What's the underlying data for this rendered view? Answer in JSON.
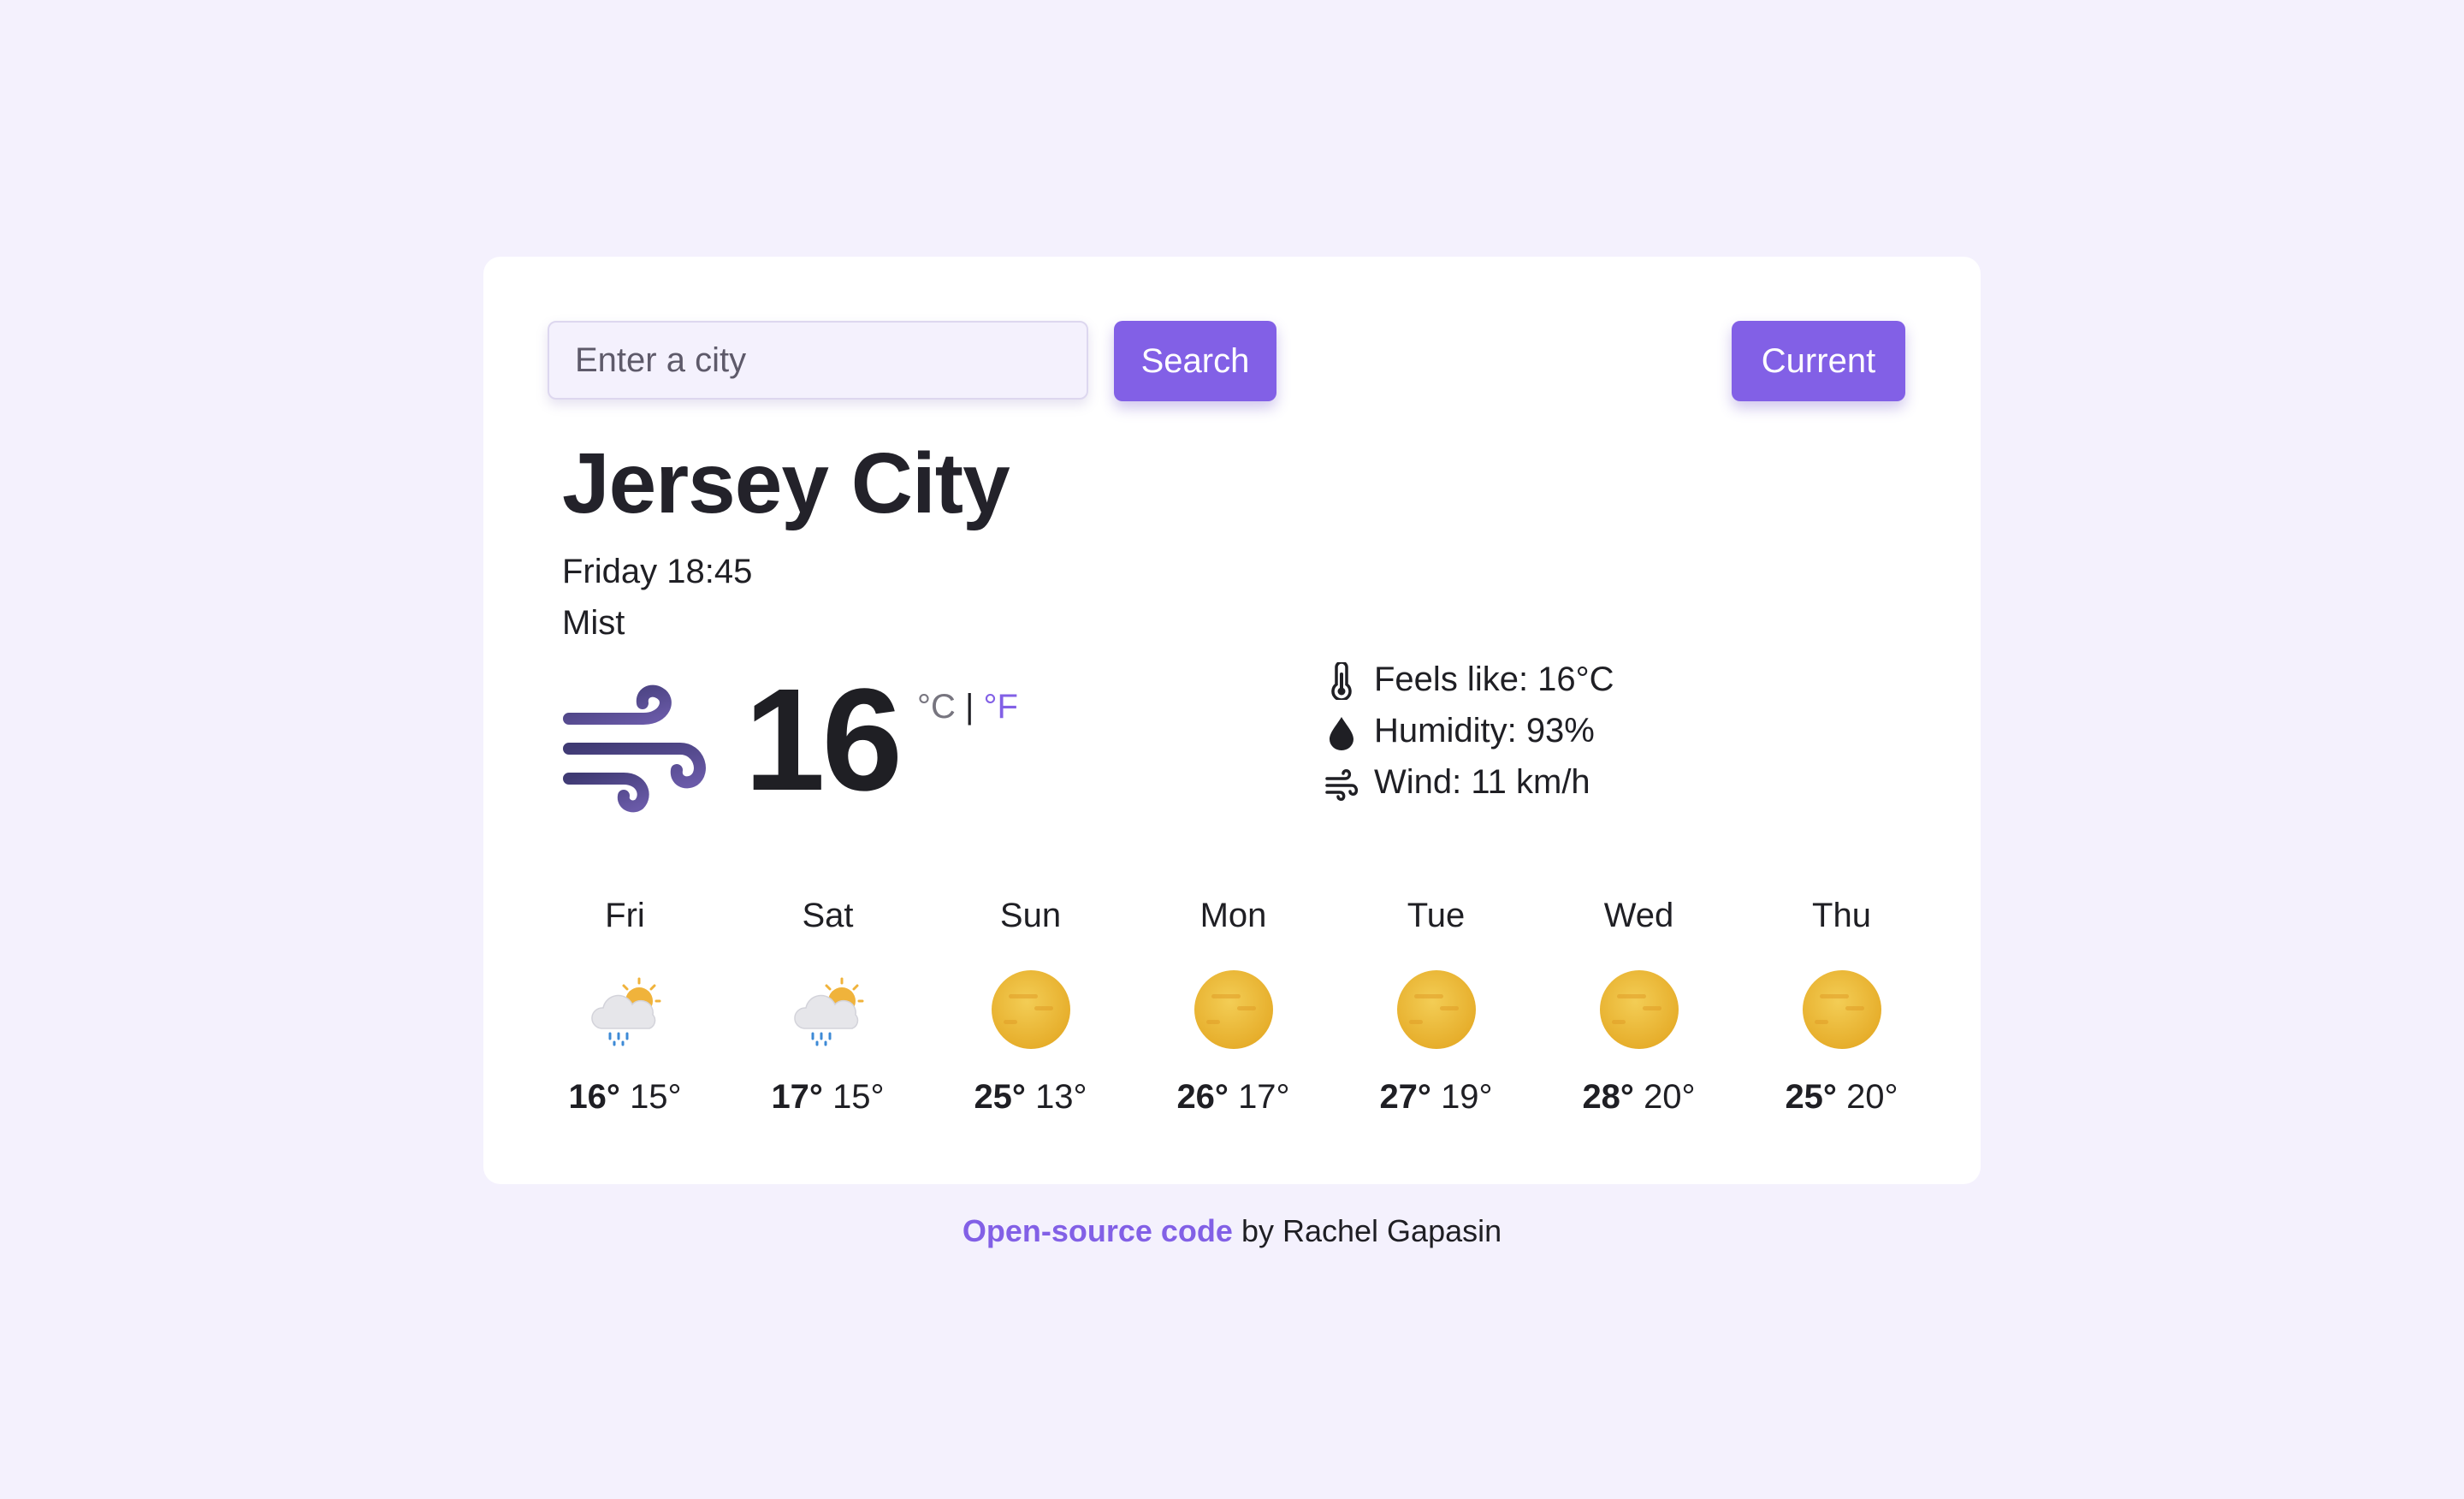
{
  "search": {
    "placeholder": "Enter a city",
    "value": "",
    "button_label": "Search"
  },
  "current_button_label": "Current",
  "city": "Jersey City",
  "datetime": "Friday 18:45",
  "condition": "Mist",
  "main_icon": "wind-icon",
  "temperature": "16",
  "units": {
    "celsius": "°C",
    "separator": "|",
    "fahrenheit": "°F"
  },
  "details": [
    {
      "icon": "thermometer-icon",
      "text": "Feels like: 16°C"
    },
    {
      "icon": "water-drop-icon",
      "text": "Humidity: 93%"
    },
    {
      "icon": "wind-icon",
      "text": "Wind: 11 km/h"
    }
  ],
  "forecast": [
    {
      "day": "Fri",
      "icon": "sun-cloud-rain-icon",
      "max": "16°",
      "min": "15°"
    },
    {
      "day": "Sat",
      "icon": "sun-cloud-rain-icon",
      "max": "17°",
      "min": "15°"
    },
    {
      "day": "Sun",
      "icon": "haze-sun-icon",
      "max": "25°",
      "min": "13°"
    },
    {
      "day": "Mon",
      "icon": "haze-sun-icon",
      "max": "26°",
      "min": "17°"
    },
    {
      "day": "Tue",
      "icon": "haze-sun-icon",
      "max": "27°",
      "min": "19°"
    },
    {
      "day": "Wed",
      "icon": "haze-sun-icon",
      "max": "28°",
      "min": "20°"
    },
    {
      "day": "Thu",
      "icon": "haze-sun-icon",
      "max": "25°",
      "min": "20°"
    }
  ],
  "footer": {
    "link_text": "Open-source code",
    "suffix": "by Rachel Gapasin"
  },
  "colors": {
    "accent": "#8260e6",
    "background": "#f4f1fd",
    "card": "#ffffff",
    "text": "#1f1f24"
  }
}
